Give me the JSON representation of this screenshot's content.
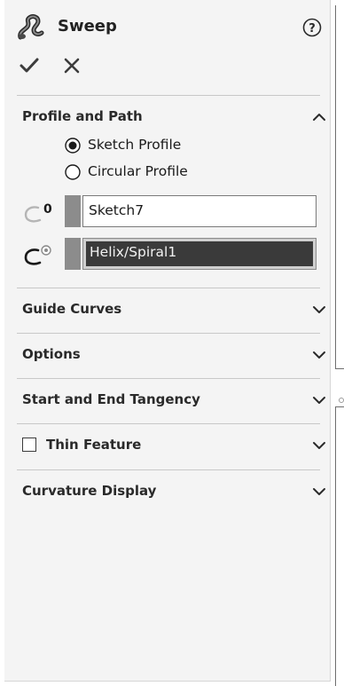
{
  "header": {
    "title": "Sweep",
    "icon": "sweep-feature-icon",
    "help_icon": "help-circle-icon"
  },
  "actions": {
    "ok_icon": "checkmark-icon",
    "cancel_icon": "close-x-icon"
  },
  "profile_and_path": {
    "label": "Profile and Path",
    "expanded": true,
    "options": [
      {
        "label": "Sketch Profile",
        "selected": true
      },
      {
        "label": "Circular Profile",
        "selected": false
      }
    ],
    "profile_field": {
      "icon": "profile-selection-icon",
      "value": "Sketch7",
      "active": false
    },
    "path_field": {
      "icon": "path-selection-icon",
      "value": "Helix/Spiral1",
      "active": true
    }
  },
  "groups": [
    {
      "label": "Guide Curves",
      "expanded": false
    },
    {
      "label": "Options",
      "expanded": false
    },
    {
      "label": "Start and End Tangency",
      "expanded": false
    },
    {
      "label": "Thin Feature",
      "expanded": false,
      "checkbox": true,
      "checked": false
    },
    {
      "label": "Curvature Display",
      "expanded": false
    }
  ],
  "colors": {
    "panel_bg": "#f4f4f4",
    "active_field_bg": "#3a3a3a",
    "swatch": "#8c8c8c"
  }
}
